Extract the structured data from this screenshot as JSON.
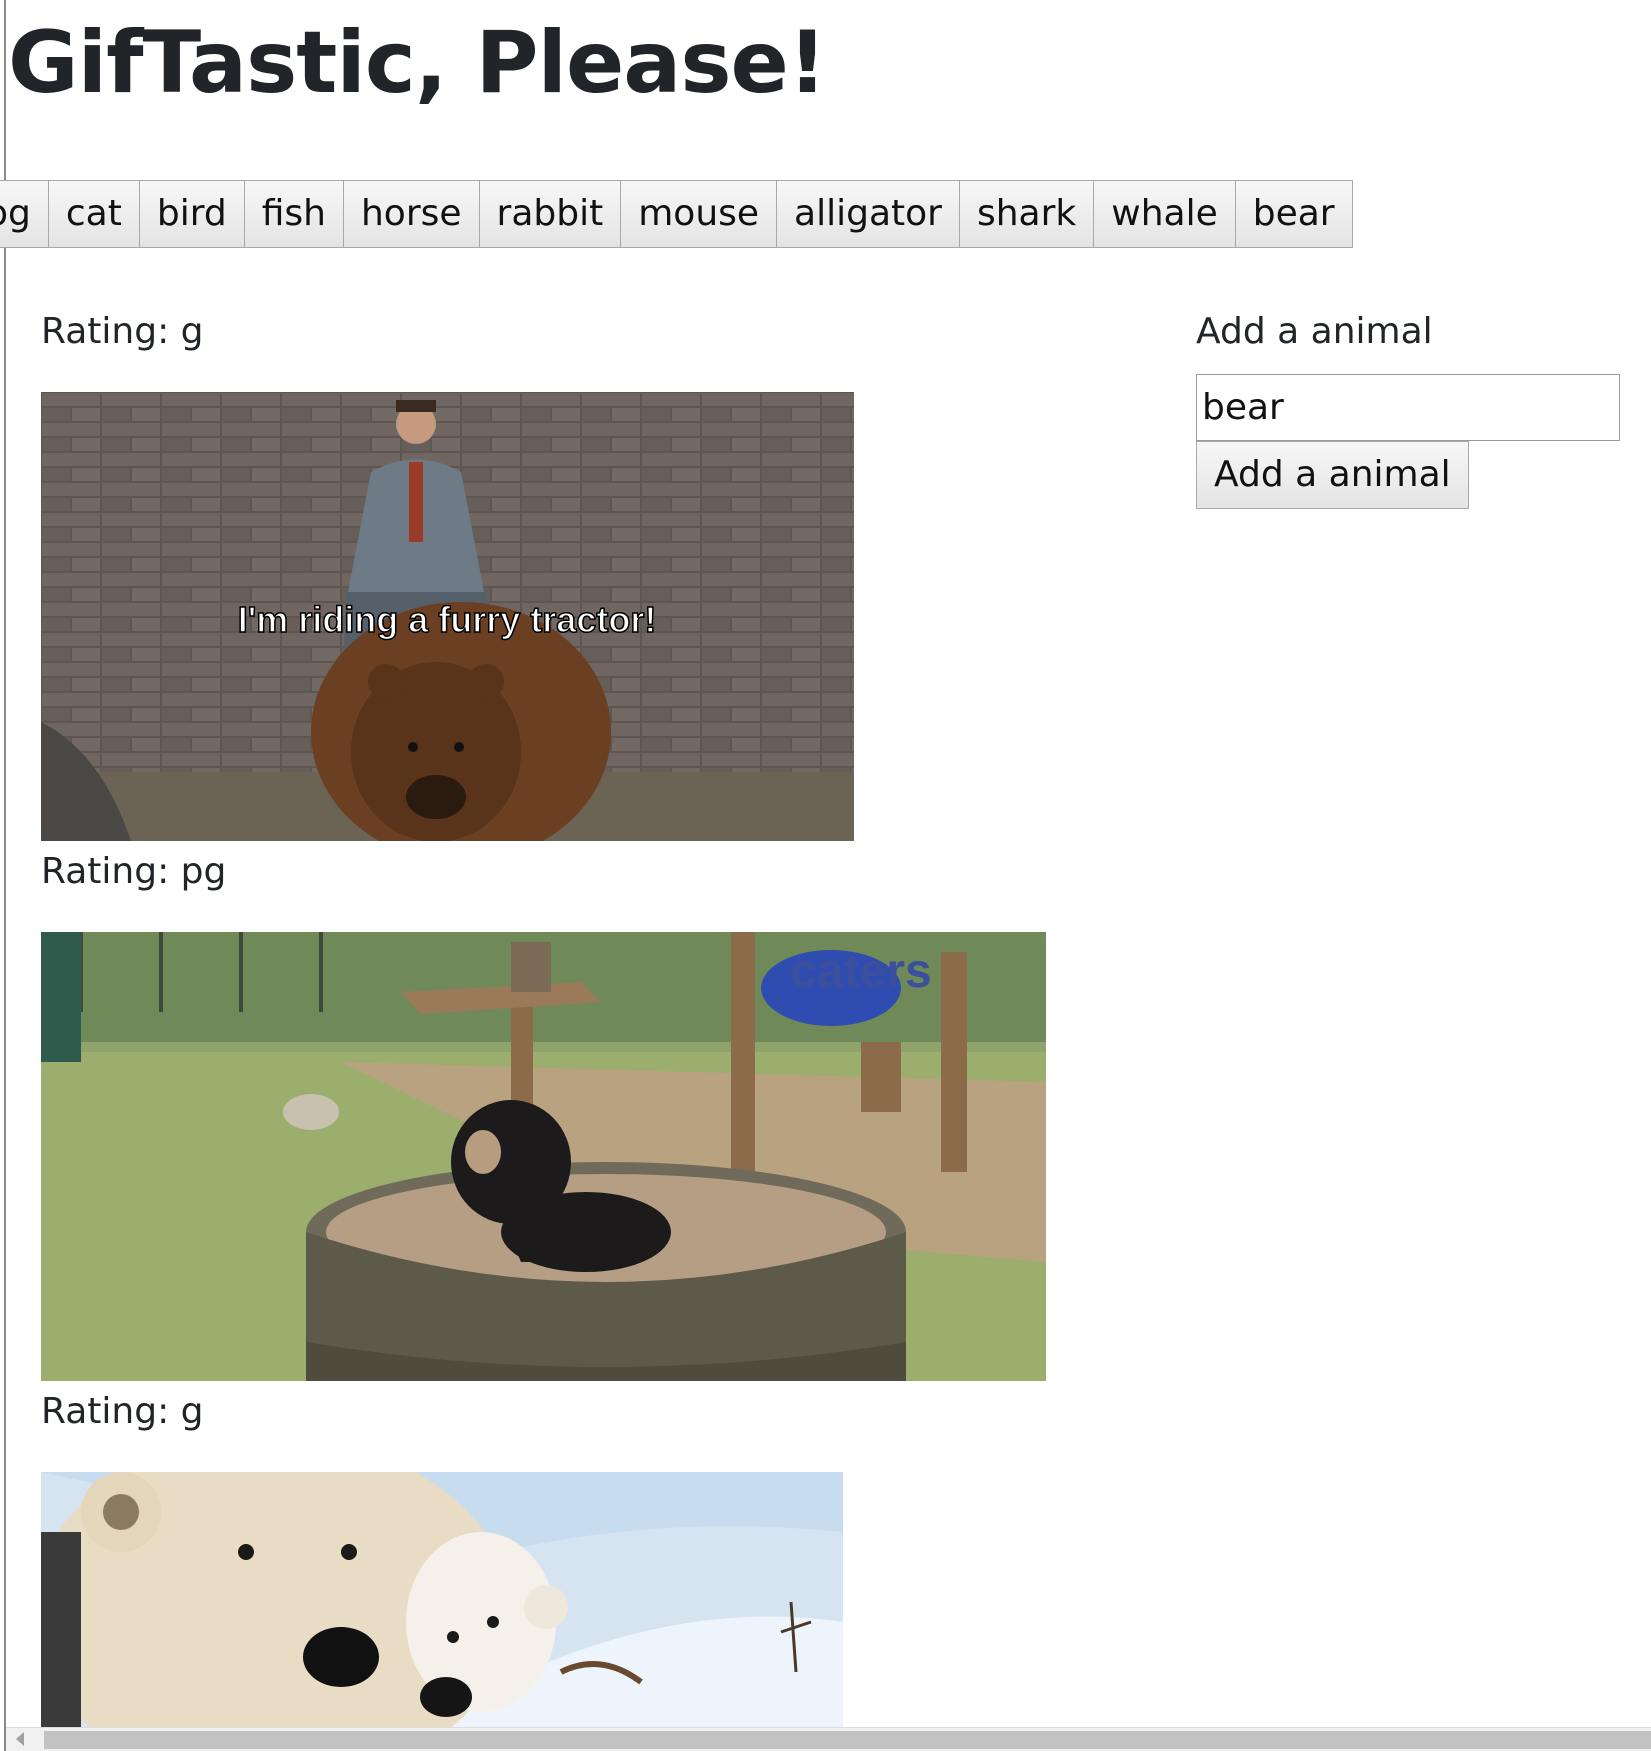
{
  "page": {
    "title": "GifTastic, Please!"
  },
  "animal_buttons": [
    "log",
    "cat",
    "bird",
    "fish",
    "horse",
    "rabbit",
    "mouse",
    "alligator",
    "shark",
    "whale",
    "bear"
  ],
  "gifs": [
    {
      "rating_label": "Rating: g",
      "caption": "I'm riding a furry tractor!",
      "subject": "man-riding-brown-bear"
    },
    {
      "rating_label": "Rating: pg",
      "caption": "caters",
      "subject": "black-bear-in-water-tub"
    },
    {
      "rating_label": "Rating: g",
      "caption": "",
      "subject": "polar-bear-mother-and-cub"
    }
  ],
  "sidebar": {
    "label": "Add a animal",
    "input_value": "bear",
    "button_label": "Add a animal"
  },
  "colors": {
    "text": "#212529",
    "button_bg": "#e9e9e9",
    "button_border": "#a9a9a9"
  }
}
